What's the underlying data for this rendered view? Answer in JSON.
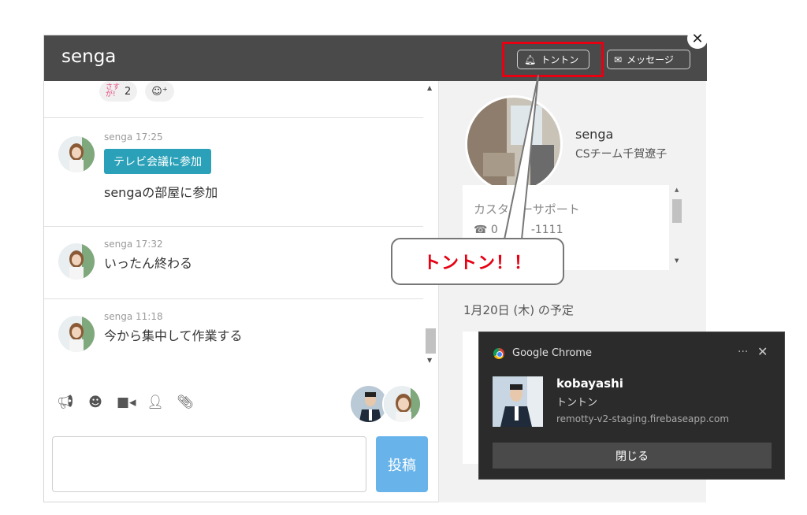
{
  "header": {
    "title": "senga",
    "tonton_label": "トントン",
    "message_label": "メッセージ"
  },
  "reactions": [
    {
      "badge": "さすが!",
      "count": "2"
    },
    {
      "icon": "smile-plus-icon",
      "count": ""
    }
  ],
  "messages": [
    {
      "author": "senga",
      "time": "17:25",
      "meta": "senga  17:25",
      "button": "テレビ会議に参加",
      "text": "sengaの部屋に参加"
    },
    {
      "author": "senga",
      "time": "17:32",
      "meta": "senga  17:32",
      "text": "いったん終わる"
    },
    {
      "author": "senga",
      "time": "11:18",
      "meta": "senga  11:18",
      "text": "今から集中して作業する"
    }
  ],
  "toolbar": [
    "megaphone-icon",
    "smiley-icon",
    "video-icon",
    "user-icon",
    "paperclip-icon"
  ],
  "composer": {
    "placeholder": "",
    "post_label": "投稿"
  },
  "profile": {
    "name": "senga",
    "team": "CSチーム千賀遼子",
    "department": "カスタマーサポート",
    "phone": "0　　　-1111",
    "schedule_title": "1月20日 (木) の予定"
  },
  "callout": {
    "text": "トントン！！"
  },
  "notification": {
    "app": "Google Chrome",
    "more": "···",
    "sender": "kobayashi",
    "body": "トントン",
    "site": "remotty-v2-staging.firebaseapp.com",
    "close_label": "閉じる"
  },
  "colors": {
    "header_bg": "#4a4a4a",
    "join_button": "#2aa1b8",
    "post_button": "#67b3ea",
    "highlight_red": "#e60012",
    "notification_bg": "#2b2b2b"
  }
}
